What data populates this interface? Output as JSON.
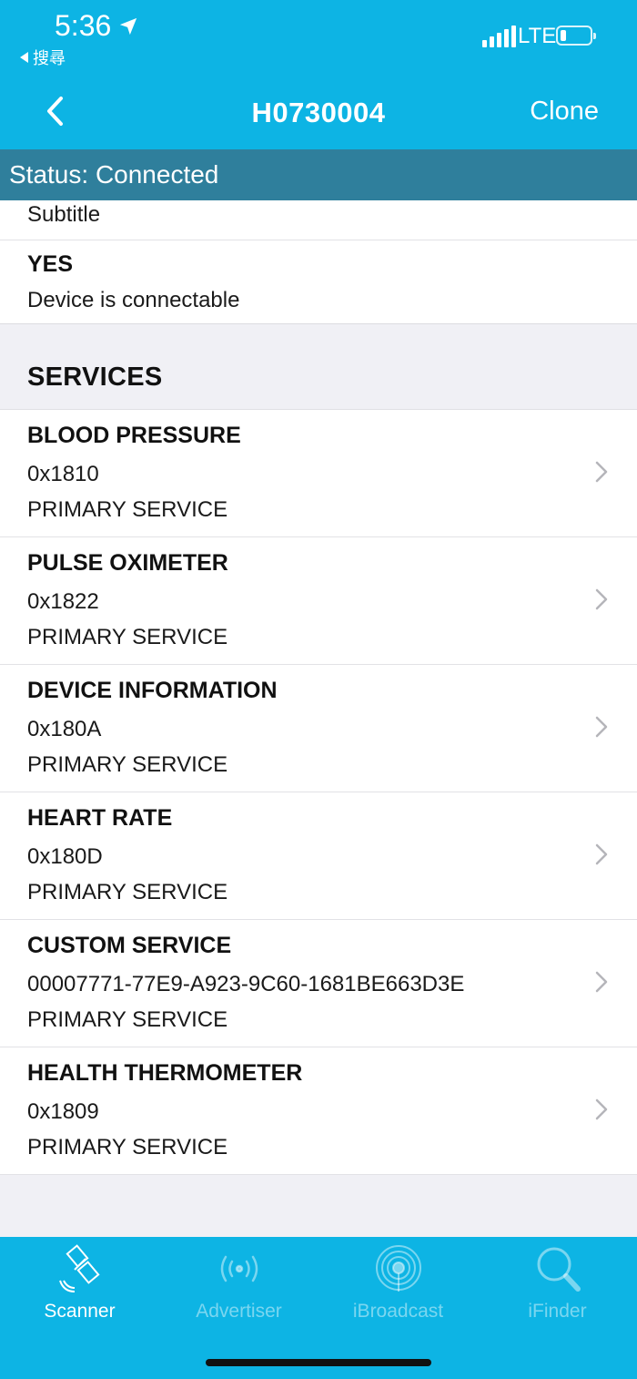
{
  "status_bar": {
    "time": "5:36",
    "back_app": "搜尋",
    "network": "LTE",
    "battery_level": 0.2
  },
  "nav": {
    "title": "H0730004",
    "clone_label": "Clone"
  },
  "status_strip": "Status: Connected",
  "info": {
    "subtitle": "Subtitle",
    "connectable_key": "YES",
    "connectable_value": "Device is connectable"
  },
  "services_header": "SERVICES",
  "services": [
    {
      "name": "BLOOD PRESSURE",
      "uuid": "0x1810",
      "type": "PRIMARY SERVICE"
    },
    {
      "name": "PULSE OXIMETER",
      "uuid": "0x1822",
      "type": "PRIMARY SERVICE"
    },
    {
      "name": "DEVICE INFORMATION",
      "uuid": "0x180A",
      "type": "PRIMARY SERVICE"
    },
    {
      "name": "HEART RATE",
      "uuid": "0x180D",
      "type": "PRIMARY SERVICE"
    },
    {
      "name": "CUSTOM SERVICE",
      "uuid": "00007771-77E9-A923-9C60-1681BE663D3E",
      "type": "PRIMARY SERVICE"
    },
    {
      "name": "HEALTH THERMOMETER",
      "uuid": "0x1809",
      "type": "PRIMARY SERVICE"
    }
  ],
  "tabs": [
    {
      "label": "Scanner",
      "icon": "satellite-icon",
      "active": true
    },
    {
      "label": "Advertiser",
      "icon": "broadcast-icon",
      "active": false
    },
    {
      "label": "iBroadcast",
      "icon": "beacon-rings-icon",
      "active": false
    },
    {
      "label": "iFinder",
      "icon": "magnifier-icon",
      "active": false
    }
  ],
  "colors": {
    "header": "#0db4e4",
    "status_strip": "#2f7f9c",
    "background": "#f0f0f5"
  }
}
